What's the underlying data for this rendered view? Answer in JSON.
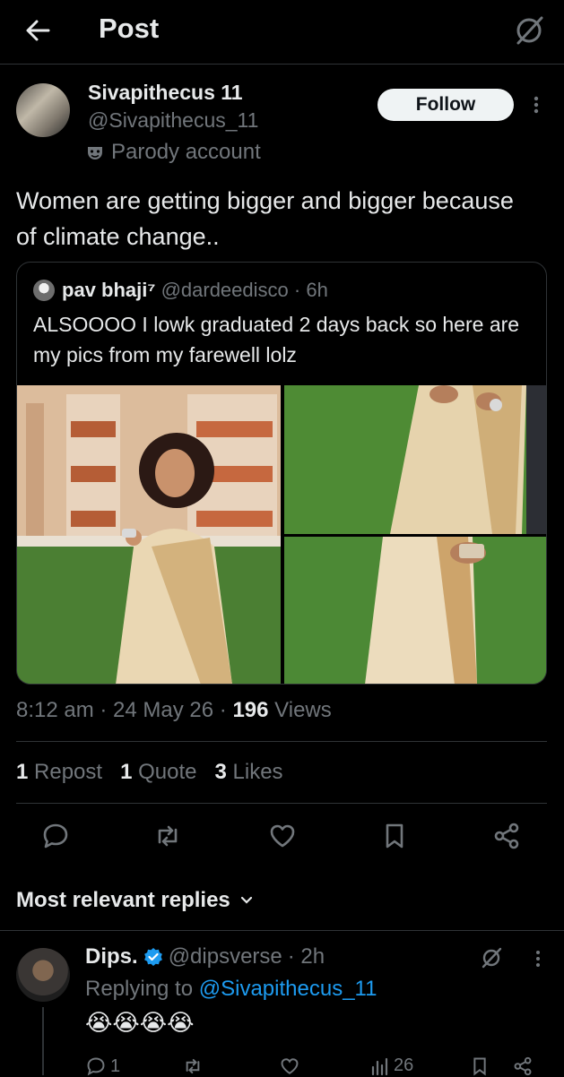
{
  "header": {
    "title": "Post"
  },
  "post": {
    "author": {
      "name": "Sivapithecus 11",
      "handle": "@Sivapithecus_11",
      "badge": "Parody account"
    },
    "follow_label": "Follow",
    "text": "Women are getting bigger and bigger because of climate change..",
    "quote": {
      "name": "pav bhaji⁷",
      "handle": "@dardeedisco",
      "time": "· 6h",
      "text": "ALSOOOO I lowk graduated 2 days back so here are my pics from my farewell lolz"
    },
    "time": "8:12 am",
    "date": "· 24 May 26 ·",
    "views_count": "196",
    "views_label": "Views",
    "stats": {
      "reposts_count": "1",
      "reposts_label": "Repost",
      "quotes_count": "1",
      "quotes_label": "Quote",
      "likes_count": "3",
      "likes_label": "Likes"
    }
  },
  "replies": {
    "header": "Most relevant replies",
    "items": [
      {
        "name": "Dips.",
        "handle": "@dipsverse",
        "time": "· 2h",
        "replying_prefix": "Replying to",
        "replying_to": "@Sivapithecus_11",
        "text": "😭😭😭😭",
        "reply_count": "1",
        "views": "26"
      }
    ]
  },
  "colors": {
    "background": "#000000",
    "text": "#e7e9ea",
    "muted": "#71767b",
    "accent": "#1d9bf0",
    "divider": "#2f3336"
  },
  "icons": [
    "back-arrow-icon",
    "grok-icon",
    "more-icon",
    "parody-mask-icon",
    "reply-icon",
    "repost-icon",
    "like-icon",
    "bookmark-icon",
    "share-icon",
    "chevron-down-icon",
    "verified-icon",
    "views-icon"
  ]
}
